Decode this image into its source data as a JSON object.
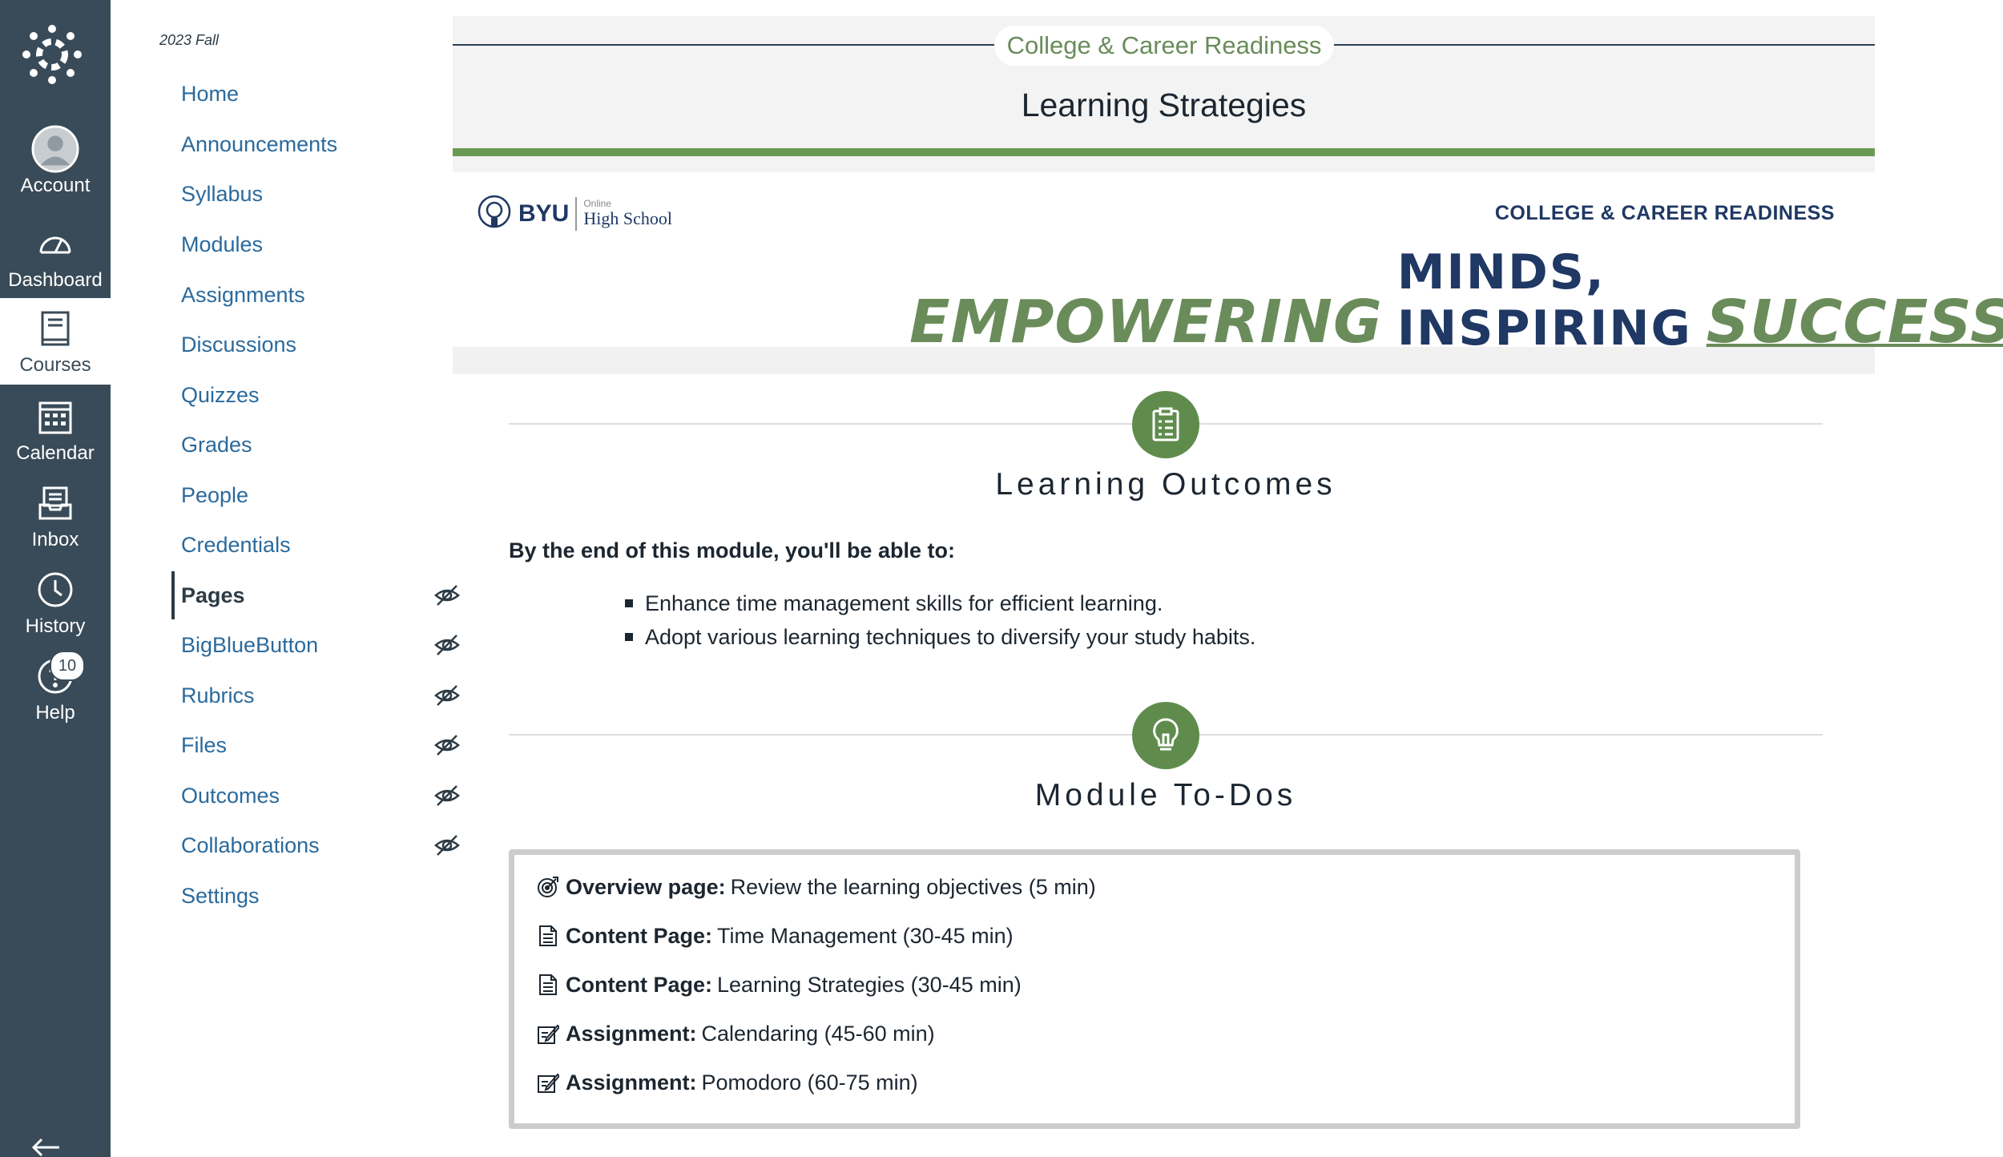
{
  "global_nav": {
    "items": [
      {
        "label": "Account",
        "icon": "account-avatar-icon"
      },
      {
        "label": "Dashboard",
        "icon": "dashboard-icon"
      },
      {
        "label": "Courses",
        "icon": "courses-icon"
      },
      {
        "label": "Calendar",
        "icon": "calendar-icon"
      },
      {
        "label": "Inbox",
        "icon": "inbox-icon"
      },
      {
        "label": "History",
        "icon": "history-icon"
      },
      {
        "label": "Help",
        "icon": "help-icon"
      }
    ],
    "help_badge": "10",
    "active": "Courses",
    "colors": {
      "background": "#394b58",
      "active_bg": "#ffffff"
    }
  },
  "course_nav": {
    "term": "2023 Fall",
    "items": [
      {
        "label": "Home",
        "hidden": false
      },
      {
        "label": "Announcements",
        "hidden": false
      },
      {
        "label": "Syllabus",
        "hidden": false
      },
      {
        "label": "Modules",
        "hidden": false
      },
      {
        "label": "Assignments",
        "hidden": false
      },
      {
        "label": "Discussions",
        "hidden": false
      },
      {
        "label": "Quizzes",
        "hidden": false
      },
      {
        "label": "Grades",
        "hidden": false
      },
      {
        "label": "People",
        "hidden": false
      },
      {
        "label": "Credentials",
        "hidden": false
      },
      {
        "label": "Pages",
        "hidden": true
      },
      {
        "label": "BigBlueButton",
        "hidden": true
      },
      {
        "label": "Rubrics",
        "hidden": true
      },
      {
        "label": "Files",
        "hidden": true
      },
      {
        "label": "Outcomes",
        "hidden": true
      },
      {
        "label": "Collaborations",
        "hidden": true
      },
      {
        "label": "Settings",
        "hidden": false
      }
    ],
    "active": "Pages",
    "link_color": "#2b6a9c"
  },
  "banner": {
    "course_pill": "College & Career Readiness",
    "page_title": "Learning Strategies",
    "accent_color": "#6a9a52"
  },
  "hero": {
    "logo_byu": "BYU",
    "logo_online": "Online",
    "logo_high_school": "High School",
    "course_label": "COLLEGE & CAREER READINESS",
    "tagline_green_1": "EMPOWERING",
    "tagline_navy": "MINDS, INSPIRING",
    "tagline_green_2": "SUCCESS"
  },
  "learning_outcomes": {
    "title": "Learning Outcomes",
    "icon": "clipboard-list-icon",
    "lead": "By the end of this module, you'll be able to:",
    "items": [
      "Enhance time management skills for efficient learning.",
      "Adopt various learning techniques to diversify your study habits."
    ]
  },
  "module_todos": {
    "title": "Module To-Dos",
    "icon": "lightbulb-icon",
    "items": [
      {
        "icon": "target-icon",
        "label": "Overview page:",
        "text": "Review the learning objectives  (5 min)"
      },
      {
        "icon": "document-icon",
        "label": "Content Page:",
        "text": "Time Management  (30-45 min)"
      },
      {
        "icon": "document-icon",
        "label": "Content Page:",
        "text": "Learning Strategies  (30-45 min)"
      },
      {
        "icon": "edit-assignment-icon",
        "label": "Assignment:",
        "text": "Calendaring  (45-60 min)"
      },
      {
        "icon": "edit-assignment-icon",
        "label": "Assignment:",
        "text": "Pomodoro  (60-75 min)"
      }
    ]
  }
}
